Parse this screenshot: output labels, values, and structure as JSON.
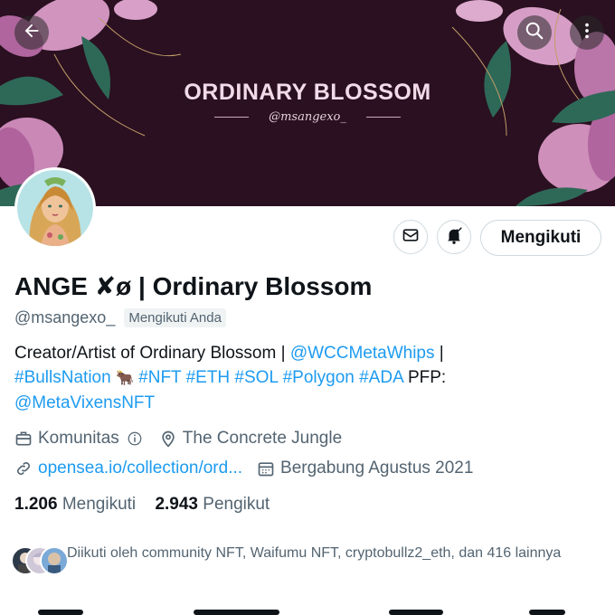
{
  "banner": {
    "title": "ORDINARY BLOSSOM",
    "handle": "@msangexo_",
    "back_icon": "arrow-left-icon",
    "search_icon": "search-icon",
    "more_icon": "more-vertical-icon"
  },
  "profile": {
    "display_name": "ANGE ✘ø | Ordinary Blossom",
    "handle": "@msangexo_",
    "follows_you": "Mengikuti Anda",
    "bio": {
      "part1": "Creator/Artist of Ordinary Blossom | ",
      "link1": "@WCCMetaWhips",
      "part2": " |",
      "tags": "#BullsNation",
      "emoji": "🐂",
      "tags2": " #NFT #ETH #SOL #Polygon #ADA",
      "part3": " PFP:",
      "link2": "@MetaVixensNFT"
    },
    "category": "Komunitas",
    "location": "The Concrete Jungle",
    "website": "opensea.io/collection/ord...",
    "joined": "Bergabung Agustus 2021",
    "following_count": "1.206",
    "following_label": "Mengikuti",
    "followers_count": "2.943",
    "followers_label": "Pengikut",
    "followed_by": "Diikuti oleh community NFT, Waifumu NFT, cryptobullz2_eth, dan 416 lainnya"
  },
  "actions": {
    "message_icon": "mail-icon",
    "notify_icon": "bell-check-icon",
    "follow_label": "Mengikuti"
  },
  "colors": {
    "link": "#1d9bf0",
    "secondary_text": "#536471",
    "banner_bg": "#2a1020"
  }
}
